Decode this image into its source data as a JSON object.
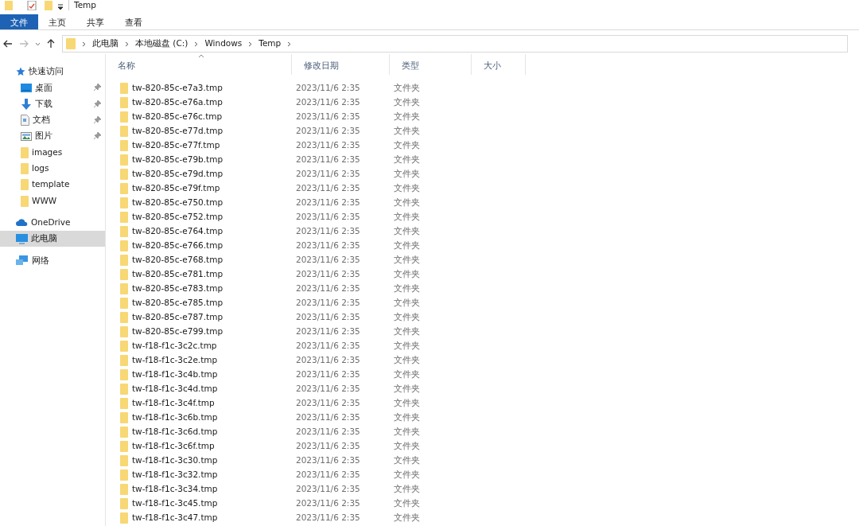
{
  "window": {
    "title": "Temp"
  },
  "ribbon_tabs": [
    {
      "label": "文件",
      "selected": true
    },
    {
      "label": "主页",
      "selected": false
    },
    {
      "label": "共享",
      "selected": false
    },
    {
      "label": "查看",
      "selected": false
    }
  ],
  "breadcrumb": [
    "此电脑",
    "本地磁盘 (C:)",
    "Windows",
    "Temp"
  ],
  "sidebar": {
    "items": [
      {
        "kind": "star",
        "label": "快速访问",
        "pinned": false,
        "selected": false,
        "indent": false
      },
      {
        "kind": "desktop",
        "label": "桌面",
        "pinned": true,
        "selected": false,
        "indent": true
      },
      {
        "kind": "download",
        "label": "下载",
        "pinned": true,
        "selected": false,
        "indent": true
      },
      {
        "kind": "document",
        "label": "文档",
        "pinned": true,
        "selected": false,
        "indent": true
      },
      {
        "kind": "picture",
        "label": "图片",
        "pinned": true,
        "selected": false,
        "indent": true
      },
      {
        "kind": "folder",
        "label": "images",
        "pinned": false,
        "selected": false,
        "indent": true
      },
      {
        "kind": "folder",
        "label": "logs",
        "pinned": false,
        "selected": false,
        "indent": true
      },
      {
        "kind": "folder",
        "label": "template",
        "pinned": false,
        "selected": false,
        "indent": true
      },
      {
        "kind": "folder",
        "label": "WWW",
        "pinned": false,
        "selected": false,
        "indent": true
      },
      {
        "kind": "cloud",
        "label": "OneDrive",
        "pinned": false,
        "selected": false,
        "indent": false
      },
      {
        "kind": "computer",
        "label": "此电脑",
        "pinned": false,
        "selected": true,
        "indent": false
      },
      {
        "kind": "network",
        "label": "网络",
        "pinned": false,
        "selected": false,
        "indent": false
      }
    ]
  },
  "table": {
    "columns": [
      "名称",
      "修改日期",
      "类型",
      "大小"
    ],
    "rows": [
      [
        "tw-820-85c-e7a3.tmp",
        "2023/11/6 2:35",
        "文件夹"
      ],
      [
        "tw-820-85c-e76a.tmp",
        "2023/11/6 2:35",
        "文件夹"
      ],
      [
        "tw-820-85c-e76c.tmp",
        "2023/11/6 2:35",
        "文件夹"
      ],
      [
        "tw-820-85c-e77d.tmp",
        "2023/11/6 2:35",
        "文件夹"
      ],
      [
        "tw-820-85c-e77f.tmp",
        "2023/11/6 2:35",
        "文件夹"
      ],
      [
        "tw-820-85c-e79b.tmp",
        "2023/11/6 2:35",
        "文件夹"
      ],
      [
        "tw-820-85c-e79d.tmp",
        "2023/11/6 2:35",
        "文件夹"
      ],
      [
        "tw-820-85c-e79f.tmp",
        "2023/11/6 2:35",
        "文件夹"
      ],
      [
        "tw-820-85c-e750.tmp",
        "2023/11/6 2:35",
        "文件夹"
      ],
      [
        "tw-820-85c-e752.tmp",
        "2023/11/6 2:35",
        "文件夹"
      ],
      [
        "tw-820-85c-e764.tmp",
        "2023/11/6 2:35",
        "文件夹"
      ],
      [
        "tw-820-85c-e766.tmp",
        "2023/11/6 2:35",
        "文件夹"
      ],
      [
        "tw-820-85c-e768.tmp",
        "2023/11/6 2:35",
        "文件夹"
      ],
      [
        "tw-820-85c-e781.tmp",
        "2023/11/6 2:35",
        "文件夹"
      ],
      [
        "tw-820-85c-e783.tmp",
        "2023/11/6 2:35",
        "文件夹"
      ],
      [
        "tw-820-85c-e785.tmp",
        "2023/11/6 2:35",
        "文件夹"
      ],
      [
        "tw-820-85c-e787.tmp",
        "2023/11/6 2:35",
        "文件夹"
      ],
      [
        "tw-820-85c-e799.tmp",
        "2023/11/6 2:35",
        "文件夹"
      ],
      [
        "tw-f18-f1c-3c2c.tmp",
        "2023/11/6 2:35",
        "文件夹"
      ],
      [
        "tw-f18-f1c-3c2e.tmp",
        "2023/11/6 2:35",
        "文件夹"
      ],
      [
        "tw-f18-f1c-3c4b.tmp",
        "2023/11/6 2:35",
        "文件夹"
      ],
      [
        "tw-f18-f1c-3c4d.tmp",
        "2023/11/6 2:35",
        "文件夹"
      ],
      [
        "tw-f18-f1c-3c4f.tmp",
        "2023/11/6 2:35",
        "文件夹"
      ],
      [
        "tw-f18-f1c-3c6b.tmp",
        "2023/11/6 2:35",
        "文件夹"
      ],
      [
        "tw-f18-f1c-3c6d.tmp",
        "2023/11/6 2:35",
        "文件夹"
      ],
      [
        "tw-f18-f1c-3c6f.tmp",
        "2023/11/6 2:35",
        "文件夹"
      ],
      [
        "tw-f18-f1c-3c30.tmp",
        "2023/11/6 2:35",
        "文件夹"
      ],
      [
        "tw-f18-f1c-3c32.tmp",
        "2023/11/6 2:35",
        "文件夹"
      ],
      [
        "tw-f18-f1c-3c34.tmp",
        "2023/11/6 2:35",
        "文件夹"
      ],
      [
        "tw-f18-f1c-3c45.tmp",
        "2023/11/6 2:35",
        "文件夹"
      ],
      [
        "tw-f18-f1c-3c47.tmp",
        "2023/11/6 2:35",
        "文件夹"
      ]
    ]
  }
}
